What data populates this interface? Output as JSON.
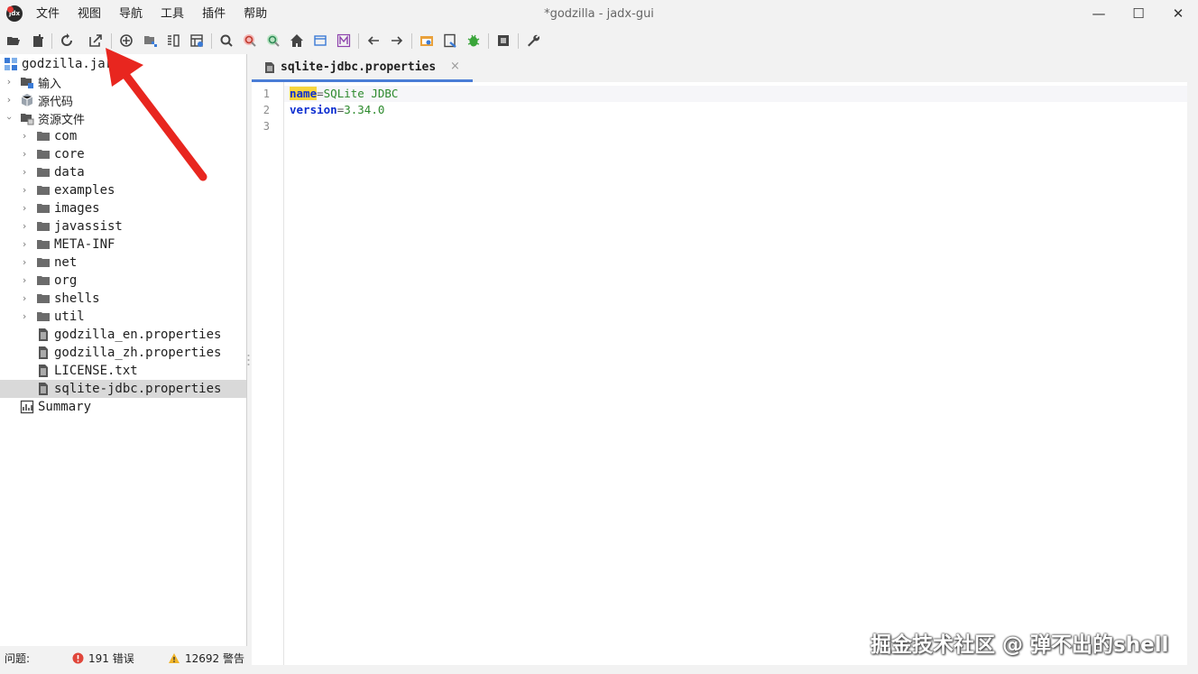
{
  "window": {
    "title": "*godzilla - jadx-gui",
    "logo_text": "jdx",
    "minimize": "—",
    "maximize": "☐",
    "close": "✕"
  },
  "menu": [
    "文件",
    "视图",
    "导航",
    "工具",
    "插件",
    "帮助"
  ],
  "toolbar_icons": [
    "open-folder-icon",
    "add-files-icon",
    "reload-icon",
    "export-icon",
    "sync-icon",
    "flatten-packages-icon",
    "split-view-icon",
    "table-icon",
    "search-icon",
    "find-class-icon",
    "find-usage-icon",
    "home-icon",
    "window-icon",
    "mnemonic-icon",
    "back-arrow-icon",
    "forward-arrow-icon",
    "deobfuscate-icon",
    "decompile-all-icon",
    "debug-bug-icon",
    "log-viewer-icon",
    "settings-wrench-icon"
  ],
  "tree": {
    "root": "godzilla.jar",
    "nodes": [
      {
        "label": "输入",
        "icon": "input-icon",
        "expanded": false
      },
      {
        "label": "源代码",
        "icon": "source-package-icon",
        "expanded": false
      },
      {
        "label": "资源文件",
        "icon": "resources-icon",
        "expanded": true
      }
    ],
    "resource_folders": [
      "com",
      "core",
      "data",
      "examples",
      "images",
      "javassist",
      "META-INF",
      "net",
      "org",
      "shells",
      "util"
    ],
    "resource_files": [
      "godzilla_en.properties",
      "godzilla_zh.properties",
      "LICENSE.txt",
      "sqlite-jdbc.properties"
    ],
    "selected_file": "sqlite-jdbc.properties",
    "summary": "Summary"
  },
  "editor": {
    "tab_label": "sqlite-jdbc.properties",
    "tab_close": "×",
    "line_numbers": [
      "1",
      "2",
      "3"
    ],
    "lines": [
      {
        "key": "name",
        "sep": "=",
        "value": "SQLite JDBC"
      },
      {
        "key": "version",
        "sep": "=",
        "value": "3.34.0"
      }
    ]
  },
  "status": {
    "label": "问题:",
    "errors": "191 错误",
    "warnings": "12692 警告"
  },
  "watermark": "掘金技术社区 @ 弹不出的shell",
  "colors": {
    "arrow": "#e8261f",
    "selection": "#d9d9d9",
    "tab_underline": "#4a7dd6",
    "keyword": "#0e2fd1",
    "string": "#2d8a2d",
    "highlight": "#f7d53d"
  }
}
